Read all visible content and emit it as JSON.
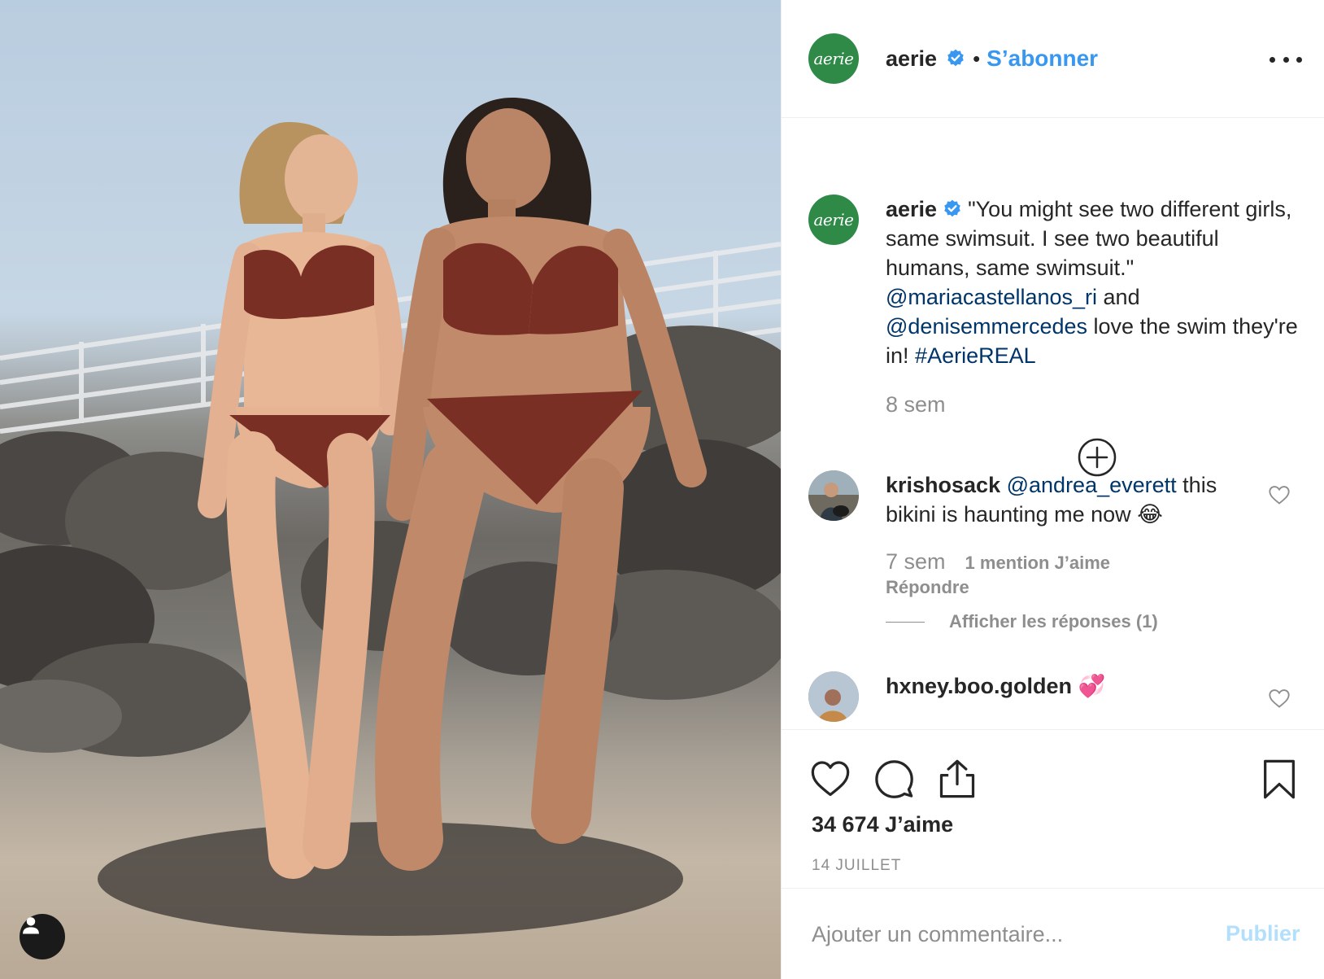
{
  "post": {
    "username": "aerie",
    "avatar_text": "aerie",
    "follow_label": "S’abonner",
    "separator": "•",
    "verified_icon": "verified-badge-icon",
    "more_icon": "more-options-icon",
    "brand_color": "#2f8a47",
    "accent_color": "#3897f0"
  },
  "caption": {
    "username": "aerie",
    "text_1": "\"You might see two different girls, same swimsuit. I see two beautiful humans, same swimsuit.\"",
    "mention_1": "@mariacastellanos_ri",
    "and": "and",
    "mention_2": "@denisemmercedes",
    "text_2": "love the swim they're in!",
    "hashtag": "#AerieREAL",
    "time": "8 sem",
    "load_more_icon": "plus-circle-icon"
  },
  "comments": [
    {
      "username": "krishosack",
      "mention": "@andrea_everett",
      "text": "this bikini is haunting me now",
      "emoji": "😂",
      "time": "7 sem",
      "likes": "1 mention J’aime",
      "reply": "Répondre",
      "view_replies": "Afficher les réponses (1)"
    },
    {
      "username": "hxney.boo.golden",
      "emoji": "💞"
    }
  ],
  "actions": {
    "like_icon": "heart-icon",
    "comment_icon": "comment-icon",
    "share_icon": "share-icon",
    "save_icon": "bookmark-icon",
    "likes_count": "34 674 J’aime",
    "date": "14 JUILLET"
  },
  "compose": {
    "placeholder": "Ajouter un commentaire...",
    "publish_label": "Publier",
    "publish_color": "#b2dffc"
  },
  "photo": {
    "tag_icon": "user-tag-icon"
  }
}
